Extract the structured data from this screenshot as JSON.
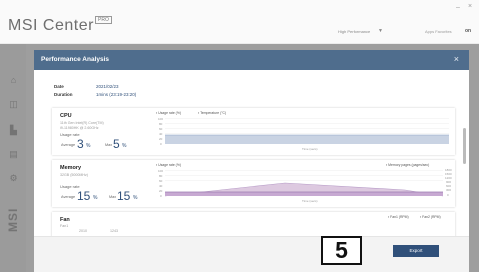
{
  "app": {
    "title": "MSI Center",
    "badge": "PRO",
    "mode": "High Performance",
    "sync": "Apps Favorites",
    "sync_icon": "on"
  },
  "sidebar": {
    "icons": [
      "home-icon",
      "gamepad-icon",
      "performance-icon",
      "toolbox-icon",
      "settings-icon"
    ],
    "logo": "MSI"
  },
  "modal": {
    "title": "Performance Analysis",
    "date_label": "Date",
    "date_value": "2021/02/23",
    "duration_label": "Duration",
    "duration_value": "1mins (23:19-23:20)"
  },
  "cpu": {
    "title": "CPU",
    "model_line1": "11th Gen Intel(R) Core(TM)",
    "model_line2": "i9-11980HK @ 2.60GHz",
    "usage_label": "Usage rate",
    "avg_label": "Average",
    "avg_value": "3",
    "max_label": "Max",
    "max_value": "5",
    "unit": "%",
    "legend_usage": "Usage rate (%)",
    "legend_temp": "Temperature (°C)",
    "x_label": "Time (secs)",
    "y_ticks": [
      "100",
      "80",
      "60",
      "40",
      "20",
      "0"
    ]
  },
  "memory": {
    "title": "Memory",
    "size": "32GB (5000MHz)",
    "usage_label": "Usage rate",
    "avg_label": "Average",
    "avg_value": "15",
    "max_label": "Max",
    "max_value": "15",
    "unit": "%",
    "legend_usage": "Usage rate (%)",
    "legend_pages": "Memory pages (pages/sec)",
    "x_label": "Time (secs)",
    "y_ticks": [
      "100",
      "80",
      "60",
      "40",
      "20",
      "0"
    ],
    "y_ticks_right": [
      "1800",
      "1500",
      "1200",
      "900",
      "600",
      "300",
      "0"
    ]
  },
  "fan": {
    "title": "Fan",
    "sub": "Fan1",
    "legend_fan1": "Fan1 (RPM)",
    "legend_fan2": "Fan2 (RPM)",
    "partial_a": "2010",
    "partial_b": "1243"
  },
  "footer": {
    "export_label": "Export"
  },
  "step": "5",
  "colors": {
    "header": "#4f6d8d",
    "accent": "#30507a",
    "cpu_fill": "#c9d3e3",
    "mem_fill": "#ddc9e0",
    "mem_line": "#9c7cb0"
  }
}
